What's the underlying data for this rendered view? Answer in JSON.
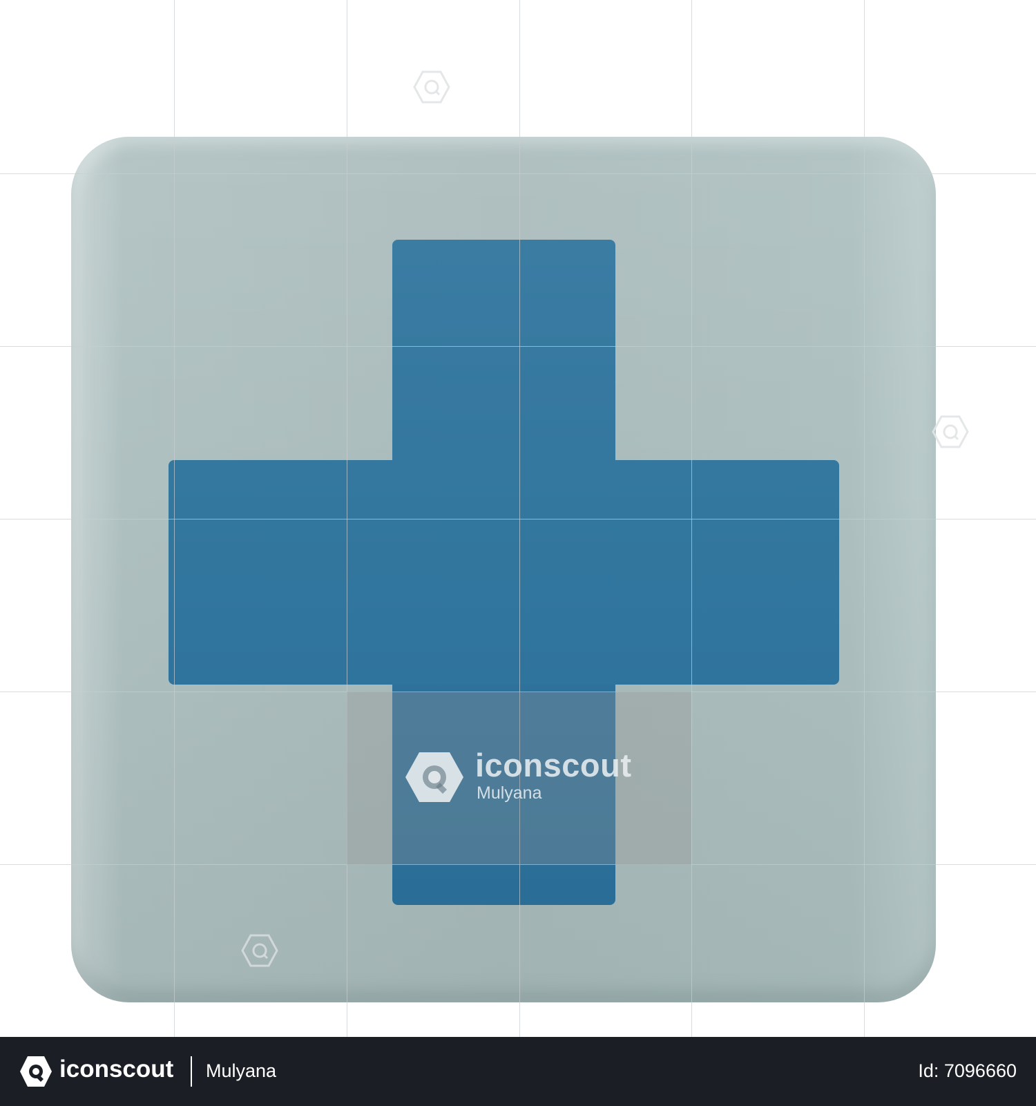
{
  "image": {
    "subject": "first-aid-cross-icon",
    "tile_color": "#aabbbb",
    "cross_color": "#31749d"
  },
  "watermark": {
    "brand": "iconscout",
    "author": "Mulyana"
  },
  "footer": {
    "brand": "iconscout",
    "author": "Mulyana",
    "id_label": "Id: 7096660",
    "background": "#1b1e24"
  }
}
